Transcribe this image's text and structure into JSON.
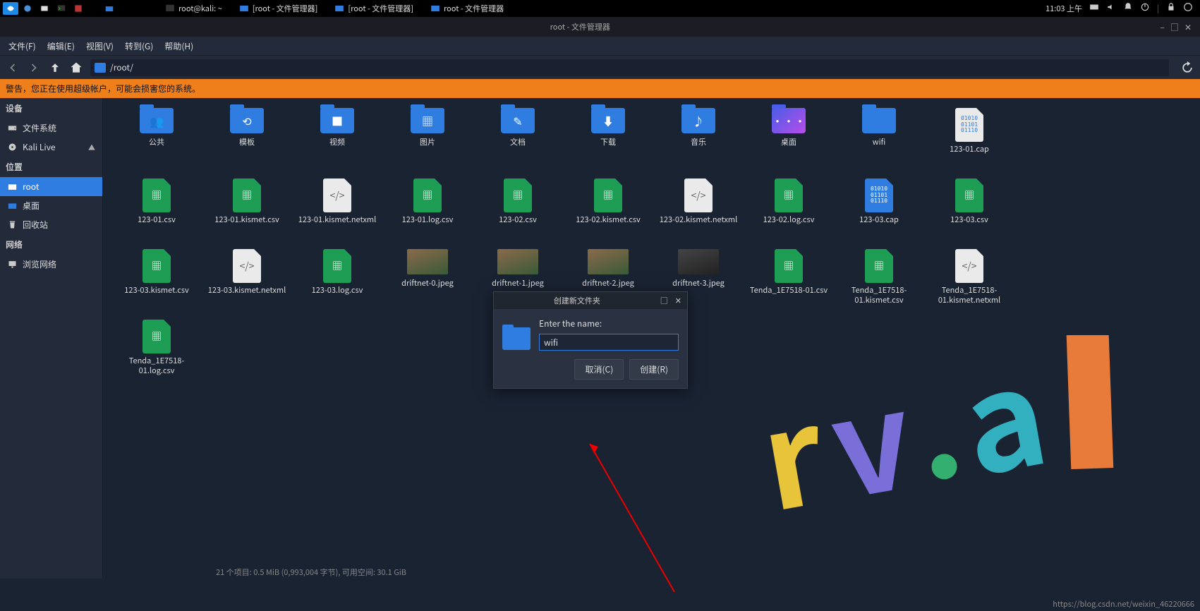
{
  "os": {
    "tasks": [
      {
        "label": "root@kali: ~",
        "icon": "terminal"
      },
      {
        "label": "[root - 文件管理器]",
        "icon": "folder"
      },
      {
        "label": "[root - 文件管理器]",
        "icon": "folder"
      },
      {
        "label": "root - 文件管理器",
        "icon": "folder"
      }
    ],
    "clock": "11:03 上午"
  },
  "window": {
    "title": "root - 文件管理器"
  },
  "menu": {
    "file": "文件(F)",
    "edit": "编辑(E)",
    "view": "视图(V)",
    "goto": "转到(G)",
    "help": "帮助(H)"
  },
  "path": "/root/",
  "warning": "警告，您正在使用超级帐户，可能会损害您的系统。",
  "sidebar": {
    "devices_head": "设备",
    "devices": [
      {
        "label": "文件系统",
        "icon": "disk"
      },
      {
        "label": "Kali Live",
        "icon": "cd",
        "eject": true
      }
    ],
    "places_head": "位置",
    "places": [
      {
        "label": "root",
        "icon": "home",
        "selected": true
      },
      {
        "label": "桌面",
        "icon": "desktop"
      },
      {
        "label": "回收站",
        "icon": "trash"
      }
    ],
    "network_head": "网络",
    "network": [
      {
        "label": "浏览网络",
        "icon": "net"
      }
    ]
  },
  "files": [
    {
      "type": "folder",
      "glyph": "people",
      "label": "公共"
    },
    {
      "type": "folder",
      "glyph": "template",
      "label": "模板"
    },
    {
      "type": "folder",
      "glyph": "video",
      "label": "视频"
    },
    {
      "type": "folder",
      "glyph": "image",
      "label": "图片"
    },
    {
      "type": "folder",
      "glyph": "doc",
      "label": "文档"
    },
    {
      "type": "folder",
      "glyph": "download",
      "label": "下载"
    },
    {
      "type": "folder",
      "glyph": "music",
      "label": "音乐"
    },
    {
      "type": "folder",
      "glyph": "desktop",
      "label": "桌面"
    },
    {
      "type": "folder",
      "glyph": "plain",
      "label": "wifi"
    },
    {
      "type": "cap",
      "label": "123-01.cap"
    },
    {
      "type": "blank"
    },
    {
      "type": "csv",
      "label": "123-01.csv"
    },
    {
      "type": "csv",
      "label": "123-01.kismet.csv"
    },
    {
      "type": "txt",
      "label": "123-01.kismet.netxml"
    },
    {
      "type": "csv",
      "label": "123-01.log.csv"
    },
    {
      "type": "csv",
      "label": "123-02.csv"
    },
    {
      "type": "csv",
      "label": "123-02.kismet.csv"
    },
    {
      "type": "txt",
      "label": "123-02.kismet.netxml"
    },
    {
      "type": "csv",
      "label": "123-02.log.csv"
    },
    {
      "type": "cap2",
      "label": "123-03.cap"
    },
    {
      "type": "csv",
      "label": "123-03.csv"
    },
    {
      "type": "blank"
    },
    {
      "type": "csv",
      "label": "123-03.kismet.csv"
    },
    {
      "type": "txt",
      "label": "123-03.kismet.netxml"
    },
    {
      "type": "csv",
      "label": "123-03.log.csv"
    },
    {
      "type": "thumb",
      "label": "driftnet-0.jpeg"
    },
    {
      "type": "thumb",
      "label": "driftnet-1.jpeg"
    },
    {
      "type": "thumb",
      "label": "driftnet-2.jpeg"
    },
    {
      "type": "thumb3",
      "label": "driftnet-3.jpeg"
    },
    {
      "type": "csv",
      "label": "Tenda_1E7518-01.csv"
    },
    {
      "type": "csv",
      "label": "Tenda_1E7518-01.kismet.csv"
    },
    {
      "type": "txt",
      "label": "Tenda_1E7518-01.kismet.netxml"
    },
    {
      "type": "blank"
    },
    {
      "type": "csv",
      "label": "Tenda_1E7518-01.log.csv"
    }
  ],
  "dialog": {
    "title": "创建新文件夹",
    "label": "Enter the name:",
    "value": "wifi",
    "cancel": "取消(C)",
    "create": "创建(R)"
  },
  "status": "21 个项目: 0.5 MiB (0,993,004 字节), 可用空间: 30.1 GiB",
  "credit": "https://blog.csdn.net/weixin_46220666"
}
